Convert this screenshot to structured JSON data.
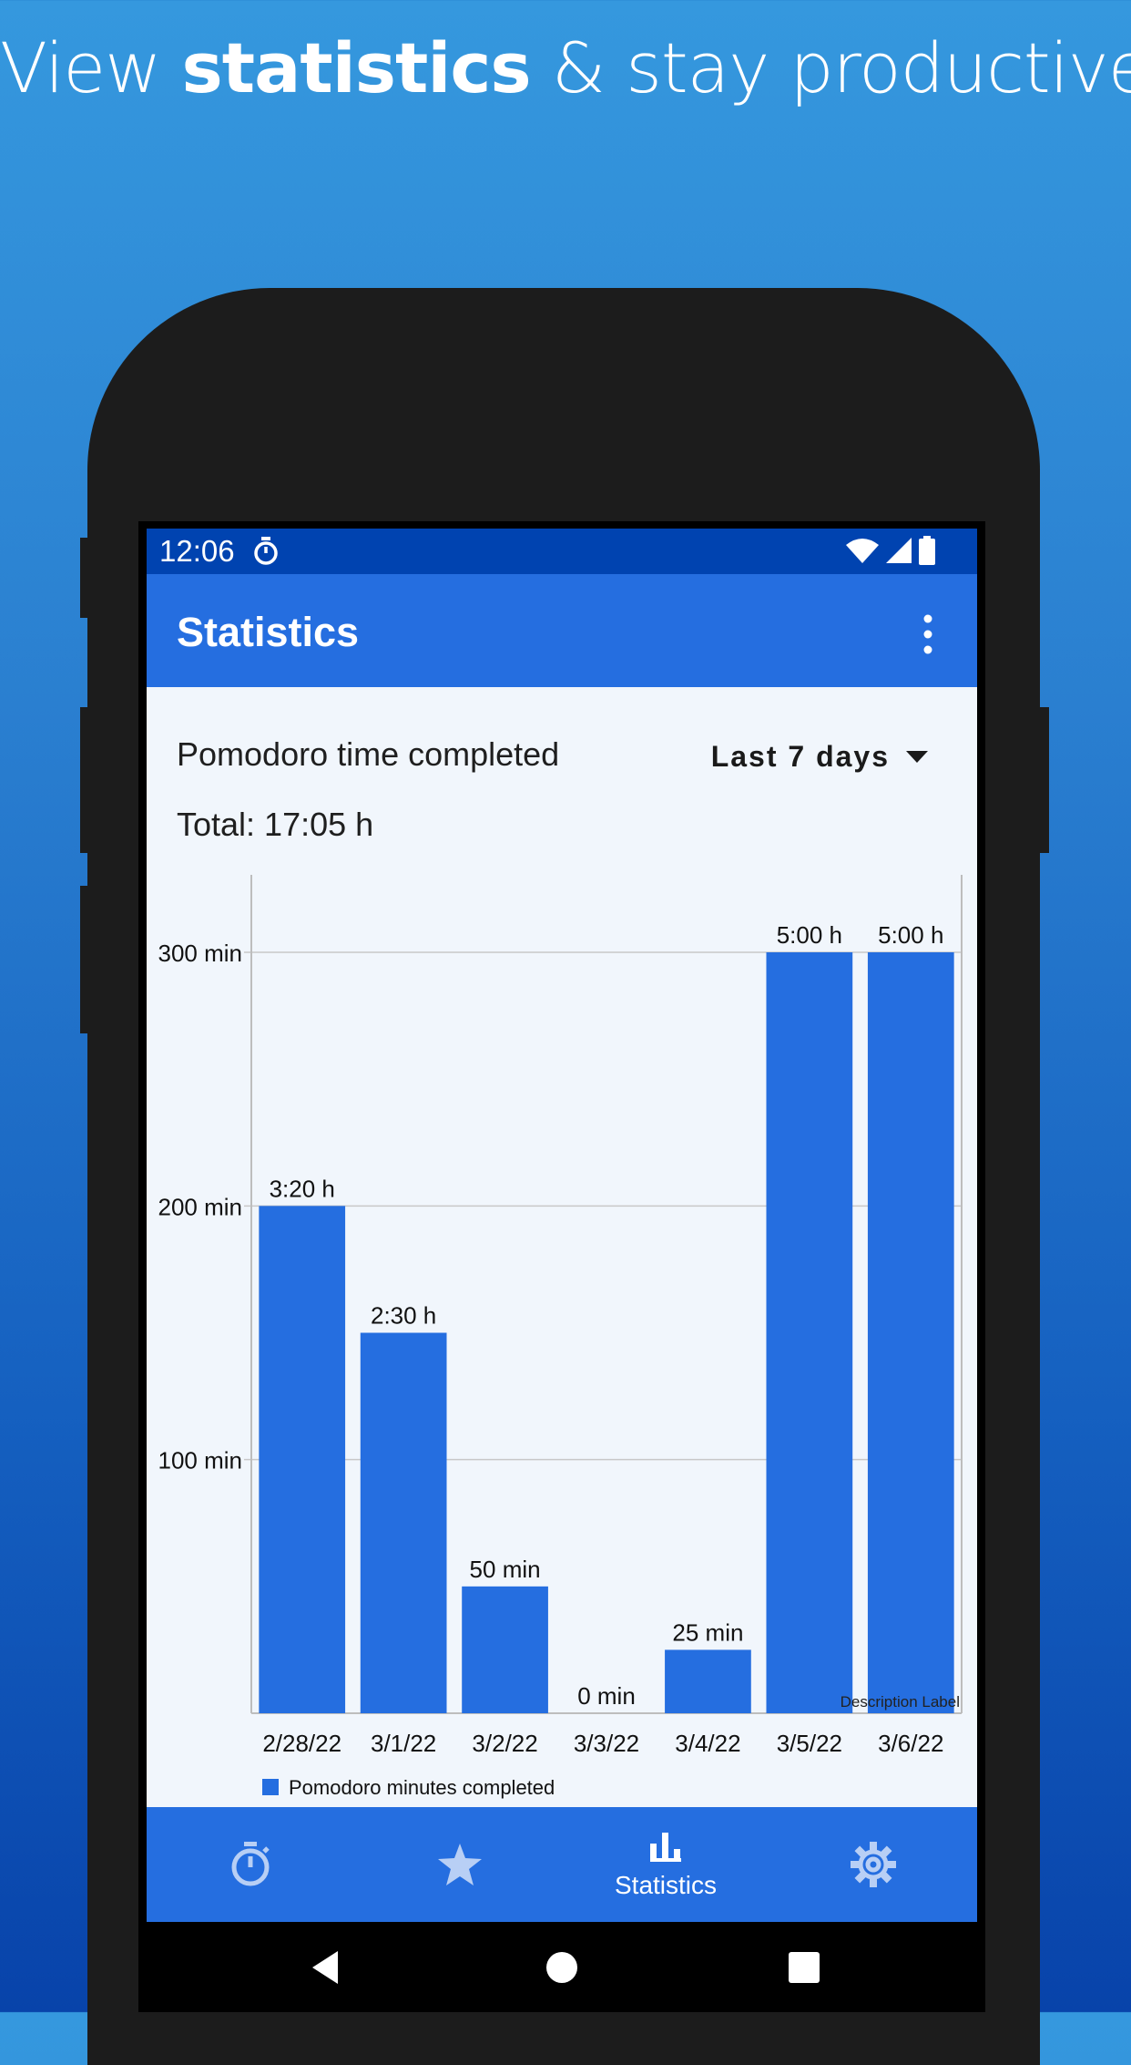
{
  "promo": {
    "prefix": "View",
    "bold": "statistics",
    "suffix": "& stay productive"
  },
  "status_bar": {
    "time": "12:06",
    "icons": [
      "timer-icon",
      "wifi-icon",
      "cell-signal-icon",
      "battery-icon"
    ]
  },
  "app_bar": {
    "title": "Statistics",
    "menu_icon": "more-vert-icon"
  },
  "stats": {
    "section_label": "Pomodoro time completed",
    "range_selector": "Last 7 days",
    "total": "Total: 17:05 h"
  },
  "chart_data": {
    "type": "bar",
    "categories": [
      "2/28/22",
      "3/1/22",
      "3/2/22",
      "3/3/22",
      "3/4/22",
      "3/5/22",
      "3/6/22"
    ],
    "series": [
      {
        "name": "Pomodoro minutes completed",
        "values": [
          200,
          150,
          50,
          0,
          25,
          300,
          300
        ],
        "data_labels": [
          "3:20 h",
          "2:30 h",
          "50 min",
          "0 min",
          "25 min",
          "5:00 h",
          "5:00 h"
        ]
      }
    ],
    "y_ticks": [
      100,
      200,
      300
    ],
    "y_tick_labels": [
      "100 min",
      "200 min",
      "300 min"
    ],
    "ylim": [
      0,
      330
    ],
    "grid": true,
    "legend": "bottom-left",
    "description_label": "Description Label",
    "bar_color": "#256ee0"
  },
  "bottom_nav": {
    "items": [
      {
        "icon": "timer-icon",
        "label": ""
      },
      {
        "icon": "star-icon",
        "label": ""
      },
      {
        "icon": "bar-chart-icon",
        "label": "Statistics"
      },
      {
        "icon": "settings-icon",
        "label": ""
      }
    ]
  },
  "system_nav": [
    "back-icon",
    "home-icon",
    "recents-icon"
  ],
  "colors": {
    "accent": "#256ee0",
    "status_bar": "#0043b0",
    "background": "#f1f6fc"
  }
}
